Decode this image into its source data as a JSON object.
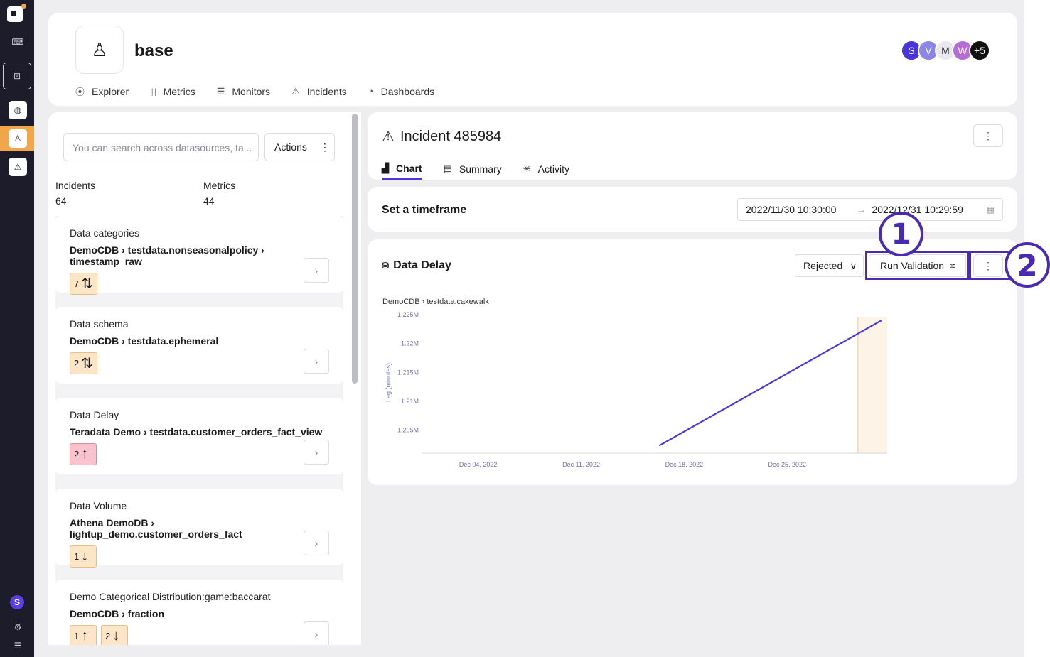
{
  "header": {
    "title": "base",
    "nav": [
      {
        "label": "Explorer",
        "icon": "compass-icon",
        "glyph": "⦿"
      },
      {
        "label": "Metrics",
        "icon": "metrics-icon",
        "glyph": "⫲⫲"
      },
      {
        "label": "Monitors",
        "icon": "list-icon",
        "glyph": "☰"
      },
      {
        "label": "Incidents",
        "icon": "warning-icon",
        "glyph": "⚠"
      },
      {
        "label": "Dashboards",
        "icon": "gauge-icon",
        "glyph": "◔"
      }
    ],
    "avatars": [
      {
        "letter": "S",
        "color": "#4a36d8"
      },
      {
        "letter": "V",
        "color": "#8b86e6"
      },
      {
        "letter": "M",
        "color": "#e8e8ee"
      },
      {
        "letter": "W",
        "color": "#b66bd6"
      },
      {
        "letter": "+5",
        "color": "#111111"
      }
    ]
  },
  "left": {
    "search_placeholder": "You can search across datasources, ta...",
    "actions_label": "Actions",
    "stats": {
      "incidents_label": "Incidents",
      "incidents_value": "64",
      "metrics_label": "Metrics",
      "metrics_value": "44"
    },
    "items": [
      {
        "title": "Data categories",
        "path": "DemoCDB › testdata.nonseasonalpolicy › timestamp_raw",
        "badges": [
          {
            "count": "7",
            "arrow": "⇅",
            "tone": "orange"
          }
        ]
      },
      {
        "title": "Data schema",
        "path": "DemoCDB › testdata.ephemeral",
        "badges": [
          {
            "count": "2",
            "arrow": "⇅",
            "tone": "orange"
          }
        ]
      },
      {
        "title": "Data Delay",
        "path": "Teradata Demo › testdata.customer_orders_fact_view",
        "badges": [
          {
            "count": "2",
            "arrow": "↑",
            "tone": "red"
          }
        ]
      },
      {
        "title": "Data Volume",
        "path": "Athena DemoDB › lightup_demo.customer_orders_fact",
        "badges": [
          {
            "count": "1",
            "arrow": "↓",
            "tone": "orange"
          }
        ]
      },
      {
        "title": "Demo Categorical Distribution:game:baccarat",
        "path": "DemoCDB › fraction",
        "badges": [
          {
            "count": "1",
            "arrow": "↑",
            "tone": "orange"
          },
          {
            "count": "2",
            "arrow": "↓",
            "tone": "orange"
          }
        ]
      }
    ]
  },
  "incident": {
    "title": "Incident 485984",
    "tabs": [
      {
        "label": "Chart",
        "icon": "bar-chart-icon",
        "glyph": "▟",
        "active": true
      },
      {
        "label": "Summary",
        "icon": "document-icon",
        "glyph": "▤",
        "active": false
      },
      {
        "label": "Activity",
        "icon": "activity-icon",
        "glyph": "✳",
        "active": false
      }
    ]
  },
  "timeframe": {
    "label": "Set a timeframe",
    "start": "2022/11/30 10:30:00",
    "end": "2022/12/31 10:29:59"
  },
  "chart_panel": {
    "title": "Data Delay",
    "status": "Rejected",
    "run_label": "Run Validation",
    "callouts": [
      "1",
      "2"
    ]
  },
  "chart_data": {
    "type": "line",
    "title": "DemoCDB › testdata.cakewalk",
    "xlabel": "",
    "ylabel": "Lag (minutes)",
    "y_ticks": [
      "1.205M",
      "1.21M",
      "1.215M",
      "1.22M",
      "1.225M"
    ],
    "y_tick_values": [
      1205000,
      1210000,
      1215000,
      1220000,
      1225000
    ],
    "x_ticks": [
      "Dec 04, 2022",
      "Dec 11, 2022",
      "Dec 18, 2022",
      "Dec 25, 2022"
    ],
    "x_tick_values": [
      4,
      11,
      18,
      25
    ],
    "xlim": [
      0.2,
      31.8
    ],
    "ylim": [
      1201000,
      1225500
    ],
    "series": [
      {
        "values": [
          [
            16.3,
            1202300
          ],
          [
            31.4,
            1224000
          ]
        ],
        "color": "#4a36d8"
      }
    ],
    "highlight_range": [
      29.8,
      31.8
    ]
  }
}
